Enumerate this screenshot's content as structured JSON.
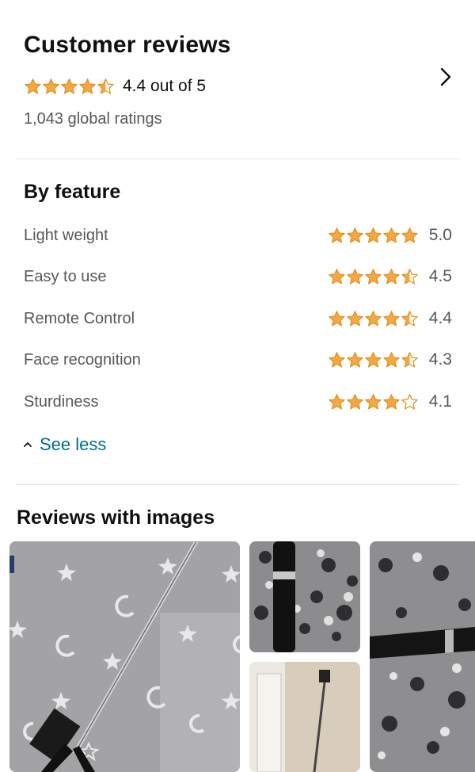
{
  "header": {
    "title": "Customer reviews",
    "rating_text": "4.4 out of 5",
    "rating": 4.4,
    "global_ratings": "1,043 global ratings"
  },
  "by_feature": {
    "title": "By feature",
    "features": [
      {
        "name": "Light weight",
        "value": "5.0",
        "rating": 5.0
      },
      {
        "name": "Easy to use",
        "value": "4.5",
        "rating": 4.5
      },
      {
        "name": "Remote Control",
        "value": "4.4",
        "rating": 4.4
      },
      {
        "name": "Face recognition",
        "value": "4.3",
        "rating": 4.3
      },
      {
        "name": "Sturdiness",
        "value": "4.1",
        "rating": 4.1
      }
    ],
    "see_less": "See less"
  },
  "reviews_with_images": {
    "title": "Reviews with images"
  },
  "colors": {
    "star": "#f3a847",
    "link": "#007185",
    "text": "#0f1111",
    "muted": "#565959"
  }
}
